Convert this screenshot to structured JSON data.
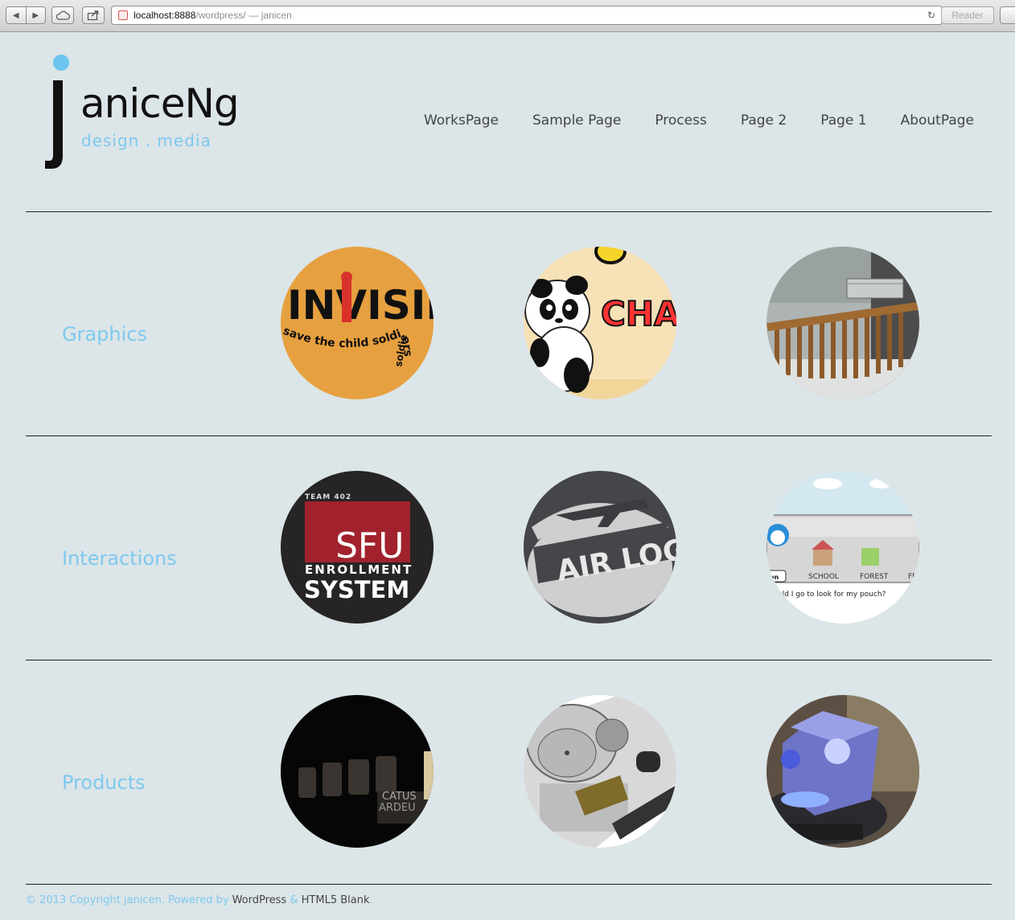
{
  "browser": {
    "url_host": "localhost:8888",
    "url_path": "/wordpress/",
    "page_title": "— janicen",
    "reader_label": "Reader",
    "back_glyph": "◀",
    "forward_glyph": "▶",
    "reload_glyph": "↻"
  },
  "site": {
    "logo_name": "aniceNg",
    "logo_tagline": "design . media",
    "accent_color": "#7ec9ee"
  },
  "nav": {
    "items": [
      {
        "label": "WorksPage"
      },
      {
        "label": "Sample Page"
      },
      {
        "label": "Process"
      },
      {
        "label": "Page 2"
      },
      {
        "label": "Page 1"
      },
      {
        "label": "AboutPage"
      }
    ]
  },
  "sections": [
    {
      "label": "Graphics"
    },
    {
      "label": "Interactions"
    },
    {
      "label": "Products"
    }
  ],
  "thumbs": {
    "invisible_text": "INVISIBL",
    "invisible_curve": "save the child soldiers",
    "invisible_curve_tail": "soldie",
    "panda_text": "CHA",
    "sfu_team": "TEAM 402",
    "sfu_title": "SFU",
    "sfu_sub1": "ENROLLMENT",
    "sfu_sub2": "SYSTEM",
    "airlog_text": "AIR LOG",
    "game_school": "SCHOOL",
    "game_forest": "FOREST",
    "game_tab": "on",
    "game_ff": "FF",
    "game_question": "uld I go to look for my pouch?",
    "award_text1": "CATUS",
    "award_text2": "ARDEU"
  },
  "footer": {
    "copyright": "© 2013 Copyright janicen. Powered by",
    "wordpress": "WordPress",
    "amp": "&",
    "html5blank": "HTML5 Blank",
    "period": "."
  }
}
